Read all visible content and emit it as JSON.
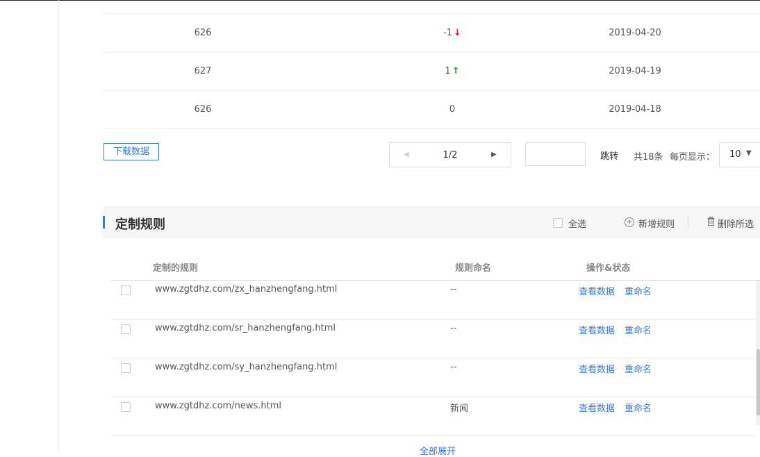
{
  "data_table": {
    "rows": [
      {
        "value": "626",
        "change": "-1",
        "arrow": "down",
        "date": "2019-04-20"
      },
      {
        "value": "627",
        "change": "1",
        "arrow": "up",
        "date": "2019-04-19"
      },
      {
        "value": "626",
        "change": "0",
        "arrow": "",
        "date": "2019-04-18"
      }
    ],
    "arrow_down_glyph": "↓",
    "arrow_up_glyph": "↑"
  },
  "toolbar": {
    "download_label": "下载数据",
    "page_indicator": "1/2",
    "jump_label": "跳转",
    "total_text": "共18条",
    "per_page_label": "每页显示：",
    "per_page_value": "10",
    "jump_placeholder": ""
  },
  "rules_section": {
    "title": "定制规则",
    "select_all_label": "全选",
    "add_rule_label": "新增规则",
    "delete_selected_label": "删除所选",
    "columns": [
      "定制的规则",
      "规则命名",
      "操作&状态"
    ],
    "rows": [
      {
        "url": "www.zgtdhz.com/zx_hanzhengfang.html",
        "name": "--",
        "view": "查看数据",
        "rename": "重命名"
      },
      {
        "url": "www.zgtdhz.com/sr_hanzhengfang.html",
        "name": "--",
        "view": "查看数据",
        "rename": "重命名"
      },
      {
        "url": "www.zgtdhz.com/sy_hanzhengfang.html",
        "name": "--",
        "view": "查看数据",
        "rename": "重命名"
      },
      {
        "url": "www.zgtdhz.com/news.html",
        "name": "新闻",
        "view": "查看数据",
        "rename": "重命名"
      }
    ],
    "expand_all_label": "全部展开"
  },
  "colors": {
    "accent": "#3b78d8",
    "down": "#e02020",
    "up": "#2b9a2b"
  }
}
